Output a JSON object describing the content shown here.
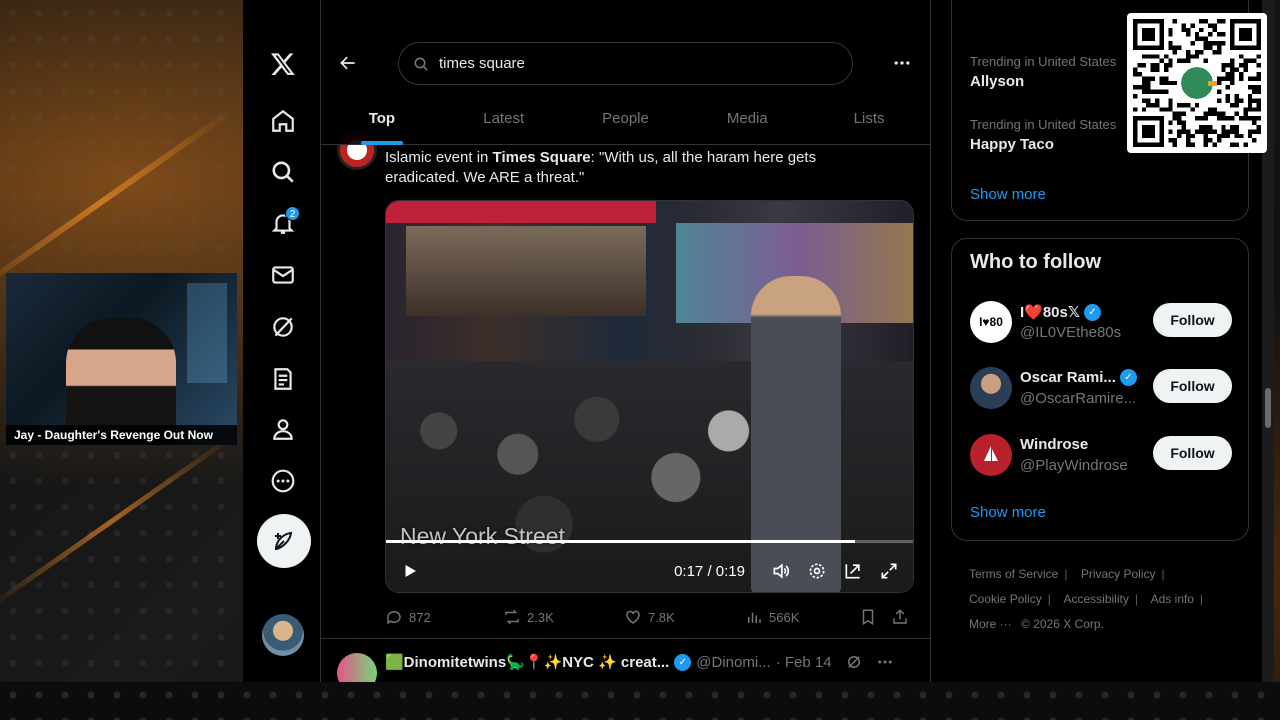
{
  "stream": {
    "lower_third": "Jay - Daughter's Revenge Out Now"
  },
  "nav": {
    "notifications_badge": "2",
    "items": [
      "x-logo",
      "home-icon",
      "search-icon",
      "bell-icon",
      "mail-icon",
      "grok-icon",
      "lists-icon",
      "profile-icon",
      "more-icon"
    ]
  },
  "search": {
    "query": "times square"
  },
  "tabs": [
    "Top",
    "Latest",
    "People",
    "Media",
    "Lists"
  ],
  "active_tab": "Top",
  "tweet": {
    "text_pre": "Islamic event in ",
    "text_bold": "Times Square",
    "text_post": ": \"With us, all the haram here gets eradicated. We ARE a threat.\"",
    "video": {
      "caption": "New York Street",
      "time_current": "0:17",
      "time_total": "0:19",
      "progress_fraction": 0.89
    },
    "stats": {
      "replies": "872",
      "reposts": "2.3K",
      "likes": "7.8K",
      "views": "566K"
    }
  },
  "tweet2": {
    "name": "🟩Dinomitetwins🦕📍✨NYC ✨ creat...",
    "handle": "@Dinomi...",
    "date": "· Feb 14"
  },
  "trending": [
    {
      "category": "Trending in United States",
      "name": "Allyson"
    },
    {
      "category": "Trending in United States",
      "name": "Happy Taco"
    }
  ],
  "trending_show_more": "Show more",
  "who_to_follow": {
    "title": "Who to follow",
    "accounts": [
      {
        "name": "I❤️80s𝕏",
        "handle": "@IL0VEthe80s",
        "verified": true,
        "button": "Follow"
      },
      {
        "name": "Oscar Rami...",
        "handle": "@OscarRamire...",
        "verified": true,
        "button": "Follow"
      },
      {
        "name": "Windrose",
        "handle": "@PlayWindrose",
        "verified": false,
        "button": "Follow"
      }
    ],
    "show_more": "Show more"
  },
  "footer": {
    "links": [
      "Terms of Service",
      "Privacy Policy",
      "Cookie Policy",
      "Accessibility",
      "Ads info",
      "More ···"
    ],
    "copyright": "© 2026 X Corp."
  },
  "colors": {
    "accent": "#1d9bf0",
    "background": "#000000",
    "muted": "#71767b"
  }
}
